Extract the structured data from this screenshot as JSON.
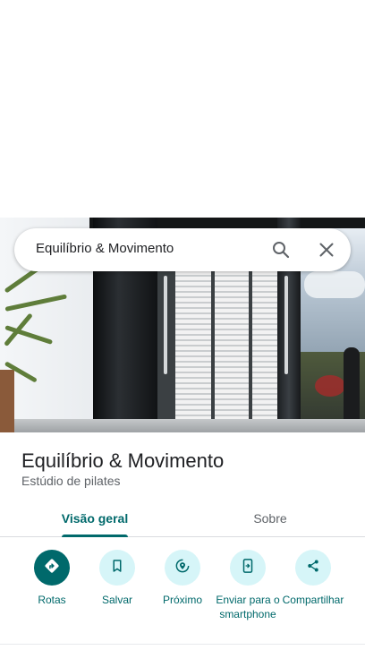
{
  "search": {
    "query": "Equilíbrio & Movimento"
  },
  "place": {
    "title": "Equilíbrio & Movimento",
    "category": "Estúdio de pilates"
  },
  "tabs": [
    {
      "label": "Visão geral",
      "active": true
    },
    {
      "label": "Sobre",
      "active": false
    }
  ],
  "actions": [
    {
      "label": "Rotas",
      "icon": "directions-icon"
    },
    {
      "label": "Salvar",
      "icon": "bookmark-icon"
    },
    {
      "label": "Próximo",
      "icon": "nearby-icon"
    },
    {
      "label": "Enviar para o smartphone",
      "icon": "send-to-phone-icon"
    },
    {
      "label": "Compartilhar",
      "icon": "share-icon"
    }
  ],
  "colors": {
    "accent": "#00696b",
    "action_bg": "#d6f5f8",
    "text": "#202124",
    "secondary_text": "#5f6368"
  }
}
